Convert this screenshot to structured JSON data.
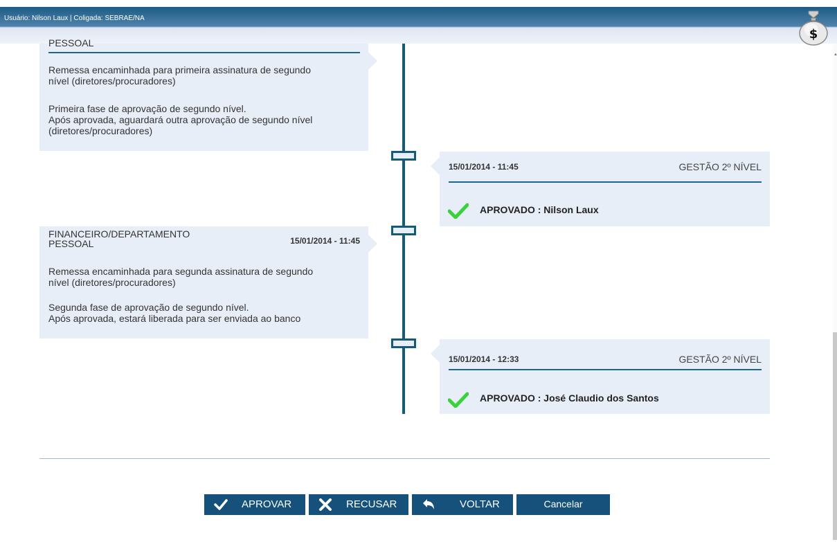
{
  "header": {
    "user_info": "Usuário: Nilson Laux | Coligada: SEBRAE/NA",
    "bag_symbol": "$"
  },
  "timeline": {
    "left_entries": [
      {
        "dept_line2": "PESSOAL",
        "text1_line1": "Remessa encaminhada para primeira assinatura de segundo",
        "text1_line2": "nível (diretores/procuradores)",
        "text2_line1": "Primeira fase de aprovação de segundo nível.",
        "text2_line2": "Após aprovada, aguardará outra aprovação de segundo nível",
        "text2_line3": "(diretores/procuradores)"
      },
      {
        "dept_line1": "FINANCEIRO/DEPARTAMENTO",
        "dept_line2": "PESSOAL",
        "date": "15/01/2014 - 11:45",
        "text1_line1": "Remessa encaminhada para segunda assinatura de segundo",
        "text1_line2": "nível (diretores/procuradores)",
        "text2_line1": "Segunda fase de aprovação de segundo nível.",
        "text2_line2": "Após aprovada, estará liberada para ser enviada ao banco"
      }
    ],
    "right_entries": [
      {
        "date": "15/01/2014 - 11:45",
        "level": "GESTÃO 2º NÍVEL",
        "status": "APROVADO : Nilson Laux"
      },
      {
        "date": "15/01/2014 - 12:33",
        "level": "GESTÃO 2º NÍVEL",
        "status": "APROVADO : José Claudio dos Santos"
      }
    ]
  },
  "actions": {
    "approve": "APROVAR",
    "refuse": "RECUSAR",
    "back": "VOLTAR",
    "cancel": "Cancelar"
  },
  "colors": {
    "accent": "#15517a",
    "card_bg": "#e8eef8",
    "check": "#3ad23a"
  }
}
